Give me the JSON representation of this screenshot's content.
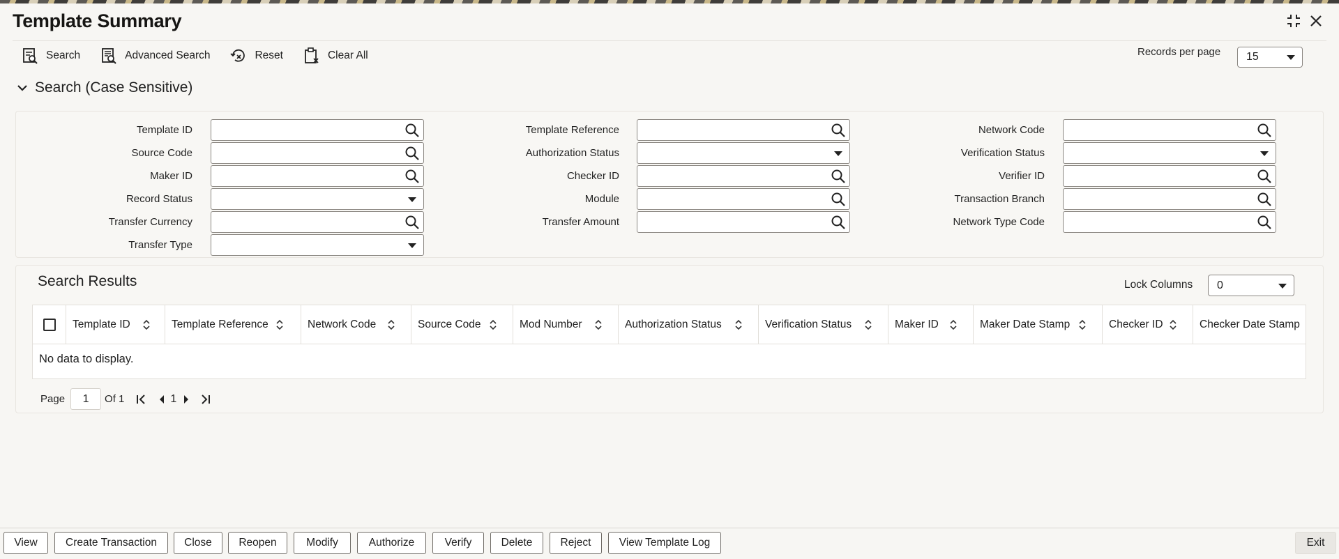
{
  "window": {
    "title": "Template Summary"
  },
  "toolbar": {
    "search": "Search",
    "advanced_search": "Advanced Search",
    "reset": "Reset",
    "clear_all": "Clear All",
    "records_per_page_label": "Records per page",
    "records_per_page_value": "15"
  },
  "search_section": {
    "title": "Search (Case Sensitive)",
    "fields": {
      "template_id": "Template ID",
      "template_reference": "Template Reference",
      "network_code": "Network Code",
      "source_code": "Source Code",
      "authorization_status": "Authorization Status",
      "verification_status": "Verification Status",
      "maker_id": "Maker ID",
      "checker_id": "Checker ID",
      "verifier_id": "Verifier ID",
      "record_status": "Record Status",
      "module": "Module",
      "transaction_branch": "Transaction Branch",
      "transfer_currency": "Transfer Currency",
      "transfer_amount": "Transfer Amount",
      "network_type_code": "Network Type Code",
      "transfer_type": "Transfer Type"
    }
  },
  "results": {
    "title": "Search Results",
    "lock_columns_label": "Lock Columns",
    "lock_columns_value": "0",
    "columns": [
      "Template ID",
      "Template Reference",
      "Network Code",
      "Source Code",
      "Mod Number",
      "Authorization Status",
      "Verification Status",
      "Maker ID",
      "Maker Date Stamp",
      "Checker ID",
      "Checker Date Stamp"
    ],
    "empty_message": "No data to display."
  },
  "pager": {
    "page_label": "Page",
    "page_value": "1",
    "of_label": "Of 1",
    "current": "1"
  },
  "footer": {
    "view": "View",
    "create_transaction": "Create Transaction",
    "close": "Close",
    "reopen": "Reopen",
    "modify": "Modify",
    "authorize": "Authorize",
    "verify": "Verify",
    "delete": "Delete",
    "reject": "Reject",
    "view_template_log": "View Template Log",
    "exit": "Exit"
  }
}
